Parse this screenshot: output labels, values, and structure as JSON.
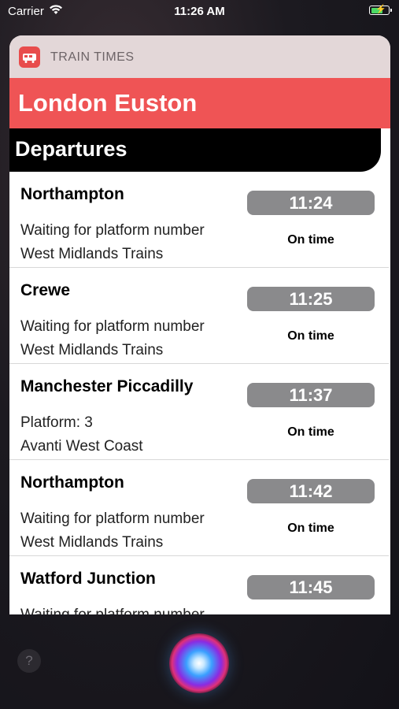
{
  "status_bar": {
    "carrier": "Carrier",
    "time": "11:26 AM",
    "battery_level": 0.7
  },
  "widget": {
    "app_name": "TRAIN TIMES",
    "station": "London Euston",
    "section_title": "Departures"
  },
  "departures": [
    {
      "destination": "Northampton",
      "platform": "Waiting for platform number",
      "operator": "West Midlands Trains",
      "time": "11:24",
      "status": "On time"
    },
    {
      "destination": "Crewe",
      "platform": "Waiting for platform number",
      "operator": "West Midlands Trains",
      "time": "11:25",
      "status": "On time"
    },
    {
      "destination": "Manchester Piccadilly",
      "platform": "Platform: 3",
      "operator": "Avanti West Coast",
      "time": "11:37",
      "status": "On time"
    },
    {
      "destination": "Northampton",
      "platform": "Waiting for platform number",
      "operator": "West Midlands Trains",
      "time": "11:42",
      "status": "On time"
    },
    {
      "destination": "Watford Junction",
      "platform": "Waiting for platform number",
      "operator": "",
      "time": "11:45",
      "status": ""
    }
  ],
  "help": {
    "label": "?"
  },
  "colors": {
    "accent": "#ef5455",
    "time_pill": "#8a8a8c"
  }
}
